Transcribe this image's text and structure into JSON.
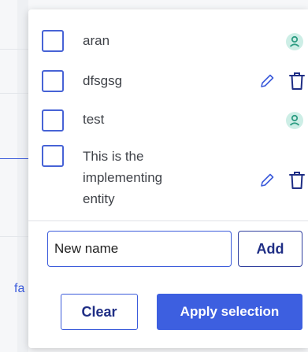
{
  "background": {
    "fragment_text": "fa"
  },
  "entities": [
    {
      "label": "aran",
      "checked": false,
      "actions": [
        "user-icon"
      ]
    },
    {
      "label": "dfsgsg",
      "checked": false,
      "actions": [
        "pencil-icon",
        "trash-icon"
      ]
    },
    {
      "label": "test",
      "checked": false,
      "actions": [
        "user-icon"
      ]
    },
    {
      "label": "This is the\nimplementing\nentity",
      "checked": false,
      "actions": [
        "pencil-icon",
        "trash-icon"
      ]
    }
  ],
  "new_name": {
    "value": "New name",
    "add_label": "Add"
  },
  "footer": {
    "clear_label": "Clear",
    "apply_label": "Apply selection"
  },
  "colors": {
    "accent": "#3d5fe0",
    "checkbox_border": "#4763d6",
    "user_badge_bg": "#cdeee6",
    "user_badge_fg": "#2c9c82"
  }
}
